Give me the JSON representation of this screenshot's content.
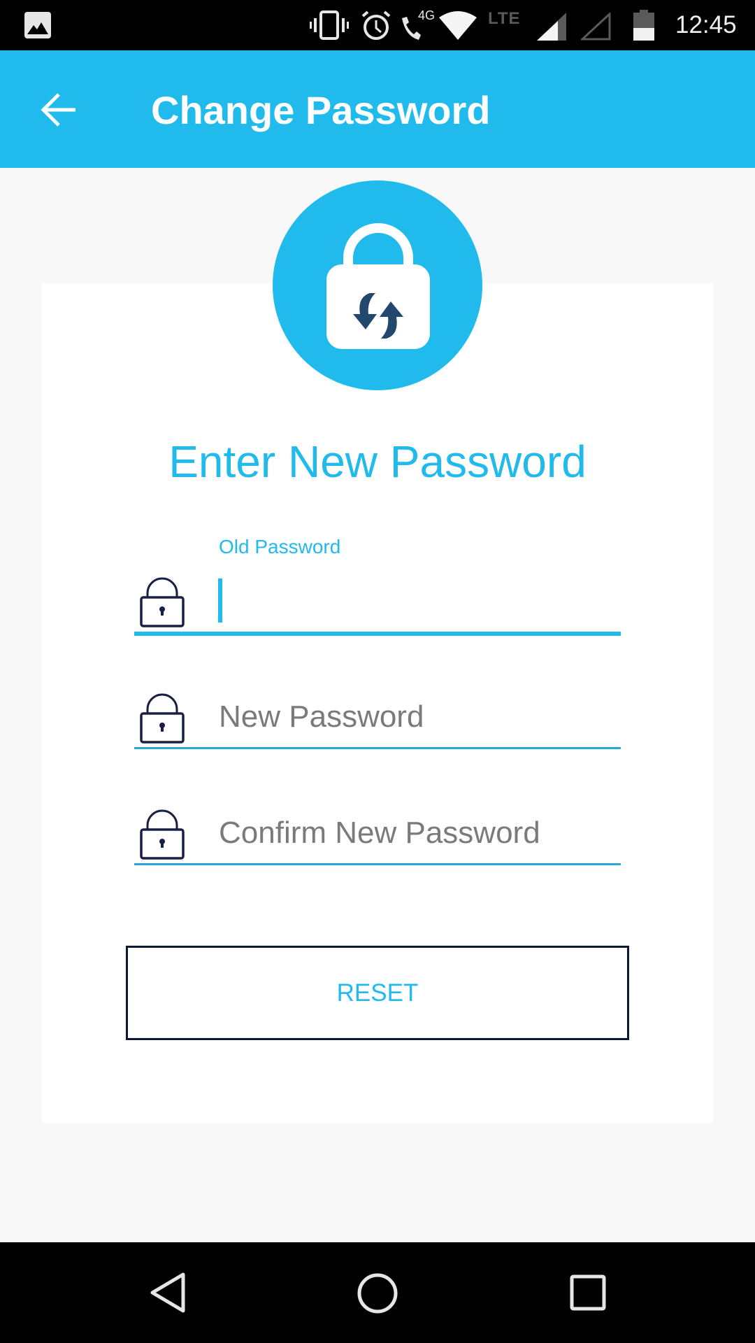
{
  "status_bar": {
    "time": "12:45",
    "network_label": "LTE",
    "call_label": "4G",
    "icons": [
      "image-notification-icon",
      "vibrate-icon",
      "alarm-icon",
      "wifi-calling-icon",
      "wifi-icon",
      "signal-icon",
      "signal-empty-icon",
      "battery-icon"
    ]
  },
  "app_bar": {
    "back_icon": "arrow-back-icon",
    "title": "Change Password"
  },
  "form": {
    "badge_icon": "lock-refresh-icon",
    "heading": "Enter New Password",
    "fields": [
      {
        "label": "Old Password",
        "value": "",
        "placeholder": "",
        "focused": true,
        "icon": "lock-icon"
      },
      {
        "label": "New Password",
        "value": "",
        "placeholder": "New Password",
        "focused": false,
        "icon": "lock-icon"
      },
      {
        "label": "Confirm New Password",
        "value": "",
        "placeholder": "Confirm New Password",
        "focused": false,
        "icon": "lock-icon"
      }
    ],
    "reset_label": "RESET"
  },
  "nav_bar": {
    "buttons": [
      "back",
      "home",
      "recents"
    ]
  },
  "colors": {
    "accent": "#20bbec",
    "outline": "#0d1736",
    "lock_arrows": "#22486e",
    "background": "#f8f8f8"
  }
}
